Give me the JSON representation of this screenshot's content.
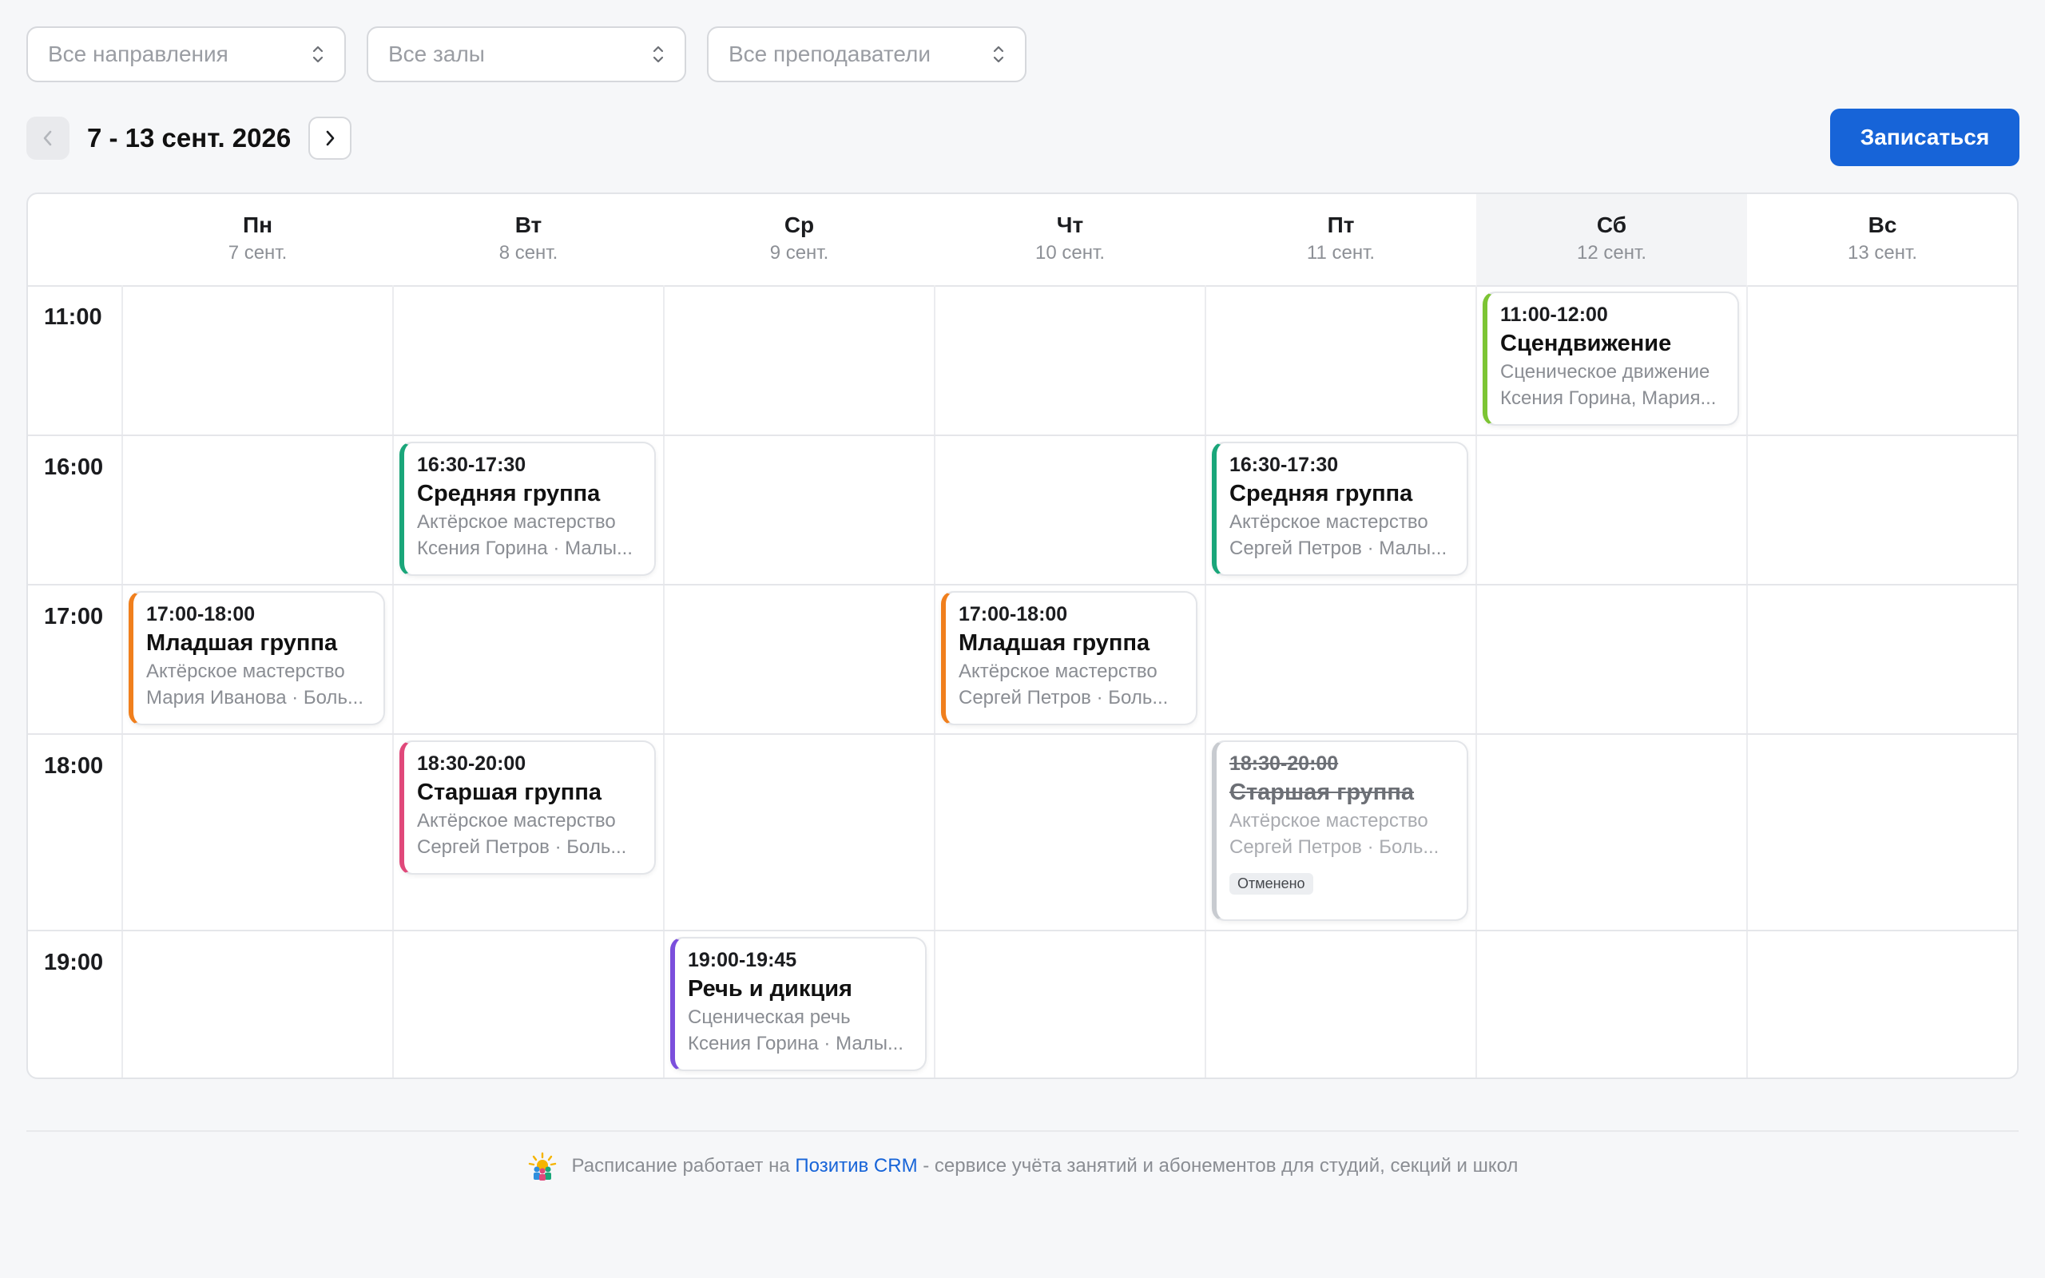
{
  "filters": [
    {
      "placeholder": "Все направления"
    },
    {
      "placeholder": "Все залы"
    },
    {
      "placeholder": "Все преподаватели"
    }
  ],
  "week": {
    "range": "7 - 13 сент. 2026"
  },
  "signup_label": "Записаться",
  "days": [
    {
      "name": "Пн",
      "date": "7 сент."
    },
    {
      "name": "Вт",
      "date": "8 сент."
    },
    {
      "name": "Ср",
      "date": "9 сент."
    },
    {
      "name": "Чт",
      "date": "10 сент."
    },
    {
      "name": "Пт",
      "date": "11 сент."
    },
    {
      "name": "Сб",
      "date": "12 сент."
    },
    {
      "name": "Вс",
      "date": "13 сент."
    }
  ],
  "times": [
    "11:00",
    "16:00",
    "17:00",
    "18:00",
    "19:00"
  ],
  "events": [
    {
      "day": 5,
      "time": "11:00-12:00",
      "title": "Сцендвижение",
      "subject": "Сценическое движение",
      "people": "Ксения Горина, Мария...",
      "color": "#7cc433",
      "cancelled": false
    },
    {
      "day": 1,
      "time": "16:30-17:30",
      "title": "Средняя группа",
      "subject": "Актёрское мастерство",
      "people": "Ксения Горина · Малы...",
      "color": "#1aa67a",
      "cancelled": false
    },
    {
      "day": 4,
      "time": "16:30-17:30",
      "title": "Средняя группа",
      "subject": "Актёрское мастерство",
      "people": "Сергей Петров · Малы...",
      "color": "#1aa67a",
      "cancelled": false
    },
    {
      "day": 0,
      "time": "17:00-18:00",
      "title": "Младшая группа",
      "subject": "Актёрское мастерство",
      "people": "Мария Иванова · Боль...",
      "color": "#f07f1d",
      "cancelled": false
    },
    {
      "day": 3,
      "time": "17:00-18:00",
      "title": "Младшая группа",
      "subject": "Актёрское мастерство",
      "people": "Сергей Петров · Боль...",
      "color": "#f07f1d",
      "cancelled": false
    },
    {
      "day": 1,
      "time": "18:30-20:00",
      "title": "Старшая группа",
      "subject": "Актёрское мастерство",
      "people": "Сергей Петров · Боль...",
      "color": "#e0487a",
      "cancelled": false
    },
    {
      "day": 4,
      "time": "18:30-20:00",
      "title": "Старшая группа",
      "subject": "Актёрское мастерство",
      "people": "Сергей Петров · Боль...",
      "color": "#c8cbd0",
      "cancelled": true,
      "badge": "Отменено"
    },
    {
      "day": 2,
      "time": "19:00-19:45",
      "title": "Речь и дикция",
      "subject": "Сценическая речь",
      "people": "Ксения Горина · Малы...",
      "color": "#7b4fdc",
      "cancelled": false
    }
  ],
  "footer": {
    "prefix": "Расписание работает на",
    "link": "Позитив CRM",
    "suffix": "- сервисе учёта занятий и абонементов для студий, секций и школ"
  }
}
